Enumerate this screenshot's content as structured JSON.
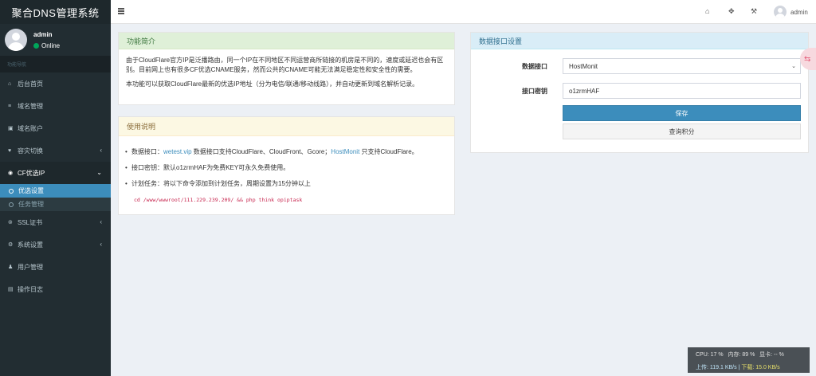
{
  "app": {
    "title": "聚合DNS管理系统"
  },
  "user": {
    "name": "admin",
    "status": "Online"
  },
  "nav": {
    "header": "功能导航",
    "items": [
      {
        "icon": "home-icon",
        "glyph": "⌂",
        "label": "后台首页"
      },
      {
        "icon": "list-icon",
        "glyph": "≡",
        "label": "域名管理"
      },
      {
        "icon": "lock-icon",
        "glyph": "🔒",
        "label": "域名账户"
      },
      {
        "icon": "heartbeat-icon",
        "glyph": "♥",
        "label": "容灾切换"
      },
      {
        "icon": "globe-icon",
        "glyph": "◉",
        "label": "CF优选IP"
      },
      {
        "icon": "ssl-icon",
        "glyph": "⊚",
        "label": "SSL证书"
      },
      {
        "icon": "cogs-icon",
        "glyph": "⚙",
        "label": "系统设置"
      },
      {
        "icon": "user-icon",
        "glyph": "♟",
        "label": "用户管理"
      },
      {
        "icon": "log-icon",
        "glyph": "▤",
        "label": "操作日志"
      }
    ],
    "sub_items": [
      {
        "label": "优选设置"
      },
      {
        "label": "任务管理"
      }
    ]
  },
  "topbar": {
    "user": "admin"
  },
  "intro": {
    "title": "功能简介",
    "p1": "由于CloudFlare官方IP是泛播路由，同一个IP在不同地区不同运营商所链接的机房是不同的，速度或延迟也会有区别。目前网上也有很多CF优选CNAME服务，然而公共的CNAME可能无法满足稳定性和安全性的需要。",
    "p2": "本功能可以获取CloudFlare最新的优选IP地址（分为电信/联通/移动线路），并自动更新到域名解析记录。"
  },
  "usage": {
    "title": "使用说明",
    "l1_prefix": "数据接口：",
    "l1_link1": "wetest.vip",
    "l1_mid": " 数据接口支持CloudFlare、CloudFront、Gcore；",
    "l1_link2": "HostMonit",
    "l1_suffix": " 只支持CloudFlare。",
    "l2": "接口密钥：默认o1zrmHAF为免费KEY可永久免费使用。",
    "l3": "计划任务：将以下命令添加到计划任务，周期设置为15分钟以上",
    "code": "cd /www/wwwroot/111.229.239.209/ && php think opiptask"
  },
  "settings": {
    "title": "数据接口设置",
    "api_label": "数据接口",
    "api_value": "HostMonit",
    "key_label": "接口密钥",
    "key_value": "o1zrmHAF",
    "save_label": "保存",
    "query_label": "查询积分"
  },
  "monitor": {
    "cpu": "CPU: 17 %",
    "mem": "内存: 89 %",
    "gpu": "显卡: -- %",
    "upload": "上传: 119.1 KB/s",
    "download": "下载: 15.0 KB/s"
  }
}
